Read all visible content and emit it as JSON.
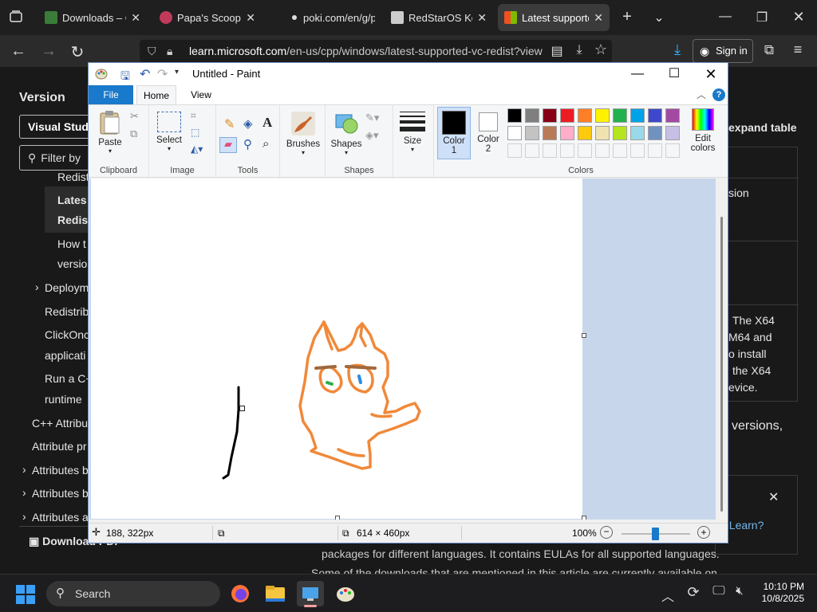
{
  "browser": {
    "tabs": [
      {
        "label": "Downloads – On",
        "icon": "downloads-favicon"
      },
      {
        "label": "Papa's Scooperi",
        "icon": "game-favicon"
      },
      {
        "label": "poki.com/en/g/p",
        "icon": "dot-favicon"
      },
      {
        "label": "RedStarOS Korea",
        "icon": "wiki-favicon"
      },
      {
        "label": "Latest supported",
        "icon": "microsoft-favicon",
        "active": true
      }
    ],
    "url_domain": "learn.microsoft.com",
    "url_path": "/en-us/cpp/windows/latest-supported-vc-redist?view",
    "sign_in_label": "Sign in"
  },
  "webpage": {
    "left_heading": "Version",
    "version_selector": "Visual Studi",
    "filter_placeholder": "Filter by",
    "nav_items": [
      "Redist",
      "Lates",
      "Redist",
      "How t",
      "versio",
      "Deploym",
      "Redistrib",
      "ClickOnc",
      "applicati",
      "Run a C+",
      "runtime",
      "C++ Attribu",
      "Attribute pr",
      "Attributes b",
      "Attributes b",
      "Attributes a"
    ],
    "download_pdf": "Download PDF",
    "expand_table": "expand table",
    "right_texts": [
      "sion",
      "The X64",
      "M64 and",
      "o install",
      "the X64",
      "evice.",
      "versions,",
      "t Learn?"
    ],
    "bottom_text_1": "packages for different languages. It contains EULAs for all supported languages.",
    "bottom_text_2": "Some of the downloads that are mentioned in this article are currently available on"
  },
  "paint": {
    "title": "Untitled - Paint",
    "tabs": {
      "file": "File",
      "home": "Home",
      "view": "View"
    },
    "groups": {
      "clipboard": "Clipboard",
      "image": "Image",
      "tools": "Tools",
      "shapes": "Shapes",
      "colors": "Colors"
    },
    "buttons": {
      "paste": "Paste",
      "select": "Select",
      "brushes": "Brushes",
      "shapes": "Shapes",
      "size": "Size",
      "color1": "Color\n1",
      "color1_a": "Color",
      "color1_b": "1",
      "color2_a": "Color",
      "color2_b": "2",
      "edit_colors_a": "Edit",
      "edit_colors_b": "colors"
    },
    "palette_row1": [
      "#000000",
      "#7f7f7f",
      "#880015",
      "#ed1c24",
      "#ff7f27",
      "#fff200",
      "#22b14c",
      "#00a2e8",
      "#3f48cc",
      "#a349a4"
    ],
    "palette_row2": [
      "#ffffff",
      "#c3c3c3",
      "#b97a57",
      "#ffaec9",
      "#ffc90e",
      "#efe4b0",
      "#b5e61d",
      "#99d9ea",
      "#7092be",
      "#c8bfe7"
    ],
    "color1": "#000000",
    "color2": "#ffffff",
    "drawing_color": "#f0893a",
    "status": {
      "cursor_pos": "188, 322px",
      "canvas_size": "614 × 460px",
      "zoom": "100%"
    }
  },
  "taskbar": {
    "search_label": "Search",
    "time": "10:10 PM",
    "date": "10/8/2025"
  }
}
